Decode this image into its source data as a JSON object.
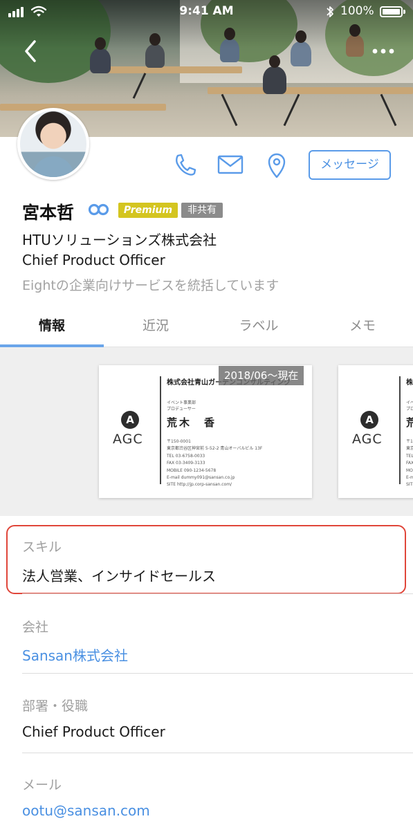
{
  "status_bar": {
    "time": "9:41 AM",
    "battery": "100%"
  },
  "profile": {
    "name": "宮本哲",
    "premium_badge": "Premium",
    "share_badge": "非共有",
    "company": "HTUソリューションズ株式会社",
    "title": "Chief Product Officer",
    "bio": "Eightの企業向けサービスを統括しています",
    "message_button": "メッセージ"
  },
  "tabs": [
    {
      "label": "情報"
    },
    {
      "label": "近況"
    },
    {
      "label": "ラベル"
    },
    {
      "label": "メモ"
    }
  ],
  "card": {
    "date_badge": "2018/06〜現在",
    "logo_letter": "A",
    "logo_text": "AGC",
    "company_name": "株式会社青山ガーデンコンサルティング",
    "dept": "イベント事業部",
    "role": "プロデューサー",
    "person_name": "荒木　香",
    "address_lines": [
      "〒150-0001",
      "東京都渋谷区神宮前 5-52-2 青山オーバルビル 13F",
      "TEL 03-6758-0033",
      "FAX 03-3409-3133",
      "MOBILE 090-1234-5678",
      "E-mail dummy091@sansan.co.jp",
      "SITE http://jp.corp-sansan.com/"
    ]
  },
  "info": {
    "skill_label": "スキル",
    "skill_value": "法人営業、インサイドセールス",
    "company_label": "会社",
    "company_value": "Sansan株式会社",
    "dept_label": "部署・役職",
    "dept_value": "Chief Product Officer",
    "mail_label": "メール",
    "mail_value": "ootu@sansan.com"
  },
  "colors": {
    "accent": "#4a90e2",
    "premium": "#d4c520",
    "highlight": "#e0463a"
  }
}
